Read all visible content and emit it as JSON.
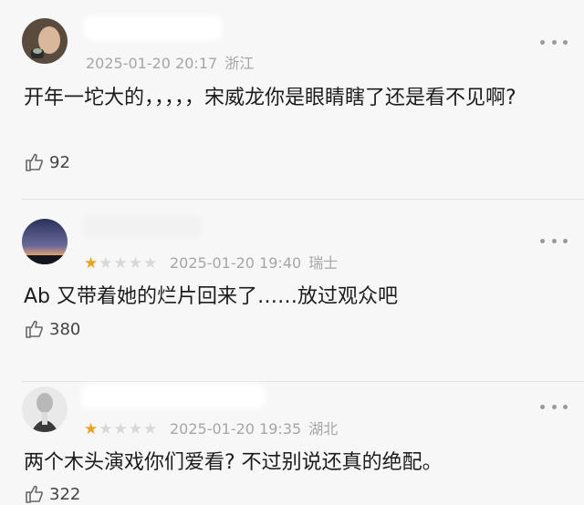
{
  "comments": [
    {
      "timestamp": "2025-01-20 20:17",
      "location": "浙江",
      "text": "开年一坨大的，，，，，宋威龙你是眼睛瞎了还是看不见啊?",
      "likes": "92",
      "rating": null
    },
    {
      "timestamp": "2025-01-20 19:40",
      "location": "瑞士",
      "text": "Ab 又带着她的烂片回来了……放过观众吧",
      "likes": "380",
      "rating": 1
    },
    {
      "timestamp": "2025-01-20 19:35",
      "location": "湖北",
      "text": "两个木头演戏你们爱看? 不过别说还真的绝配。",
      "likes": "322",
      "rating": 1
    }
  ],
  "icons": {
    "more": "more-dots-icon",
    "like": "thumbs-up-icon",
    "star": "star-icon"
  },
  "colors": {
    "star_on": "#f1a11d",
    "star_off": "#d8d8d8",
    "meta": "#a6a6a6"
  }
}
